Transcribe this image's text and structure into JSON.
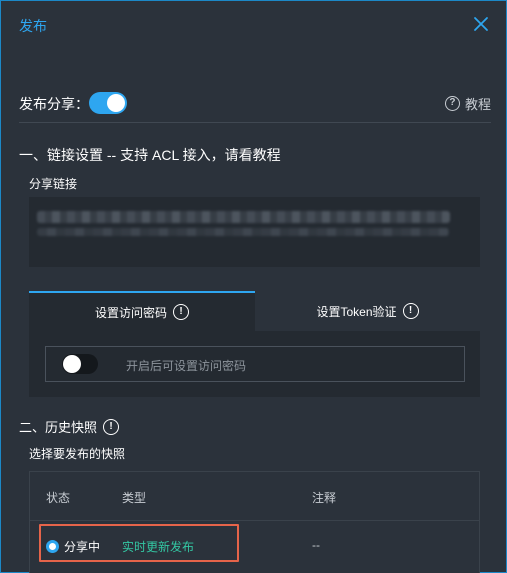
{
  "dialog": {
    "title": "发布"
  },
  "publish": {
    "label": "发布分享：",
    "enabled": true,
    "tutorial_label": "教程"
  },
  "section1": {
    "title": "一、链接设置 -- 支持 ACL 接入，请看教程",
    "share_link_label": "分享链接"
  },
  "tabs": [
    {
      "label": "设置访问密码",
      "active": true
    },
    {
      "label": "设置Token验证",
      "active": false
    }
  ],
  "password": {
    "enabled": false,
    "hint": "开启后可设置访问密码"
  },
  "section2": {
    "title": "二、历史快照",
    "choose_label": "选择要发布的快照"
  },
  "table": {
    "columns": [
      "状态",
      "类型",
      "注释"
    ],
    "rows": [
      {
        "status": "分享中",
        "type": "实时更新发布",
        "note": "--",
        "selected": true
      }
    ]
  },
  "colors": {
    "accent": "#2ea6f0",
    "type_green": "#33c7a3",
    "highlight": "#e5644a"
  }
}
